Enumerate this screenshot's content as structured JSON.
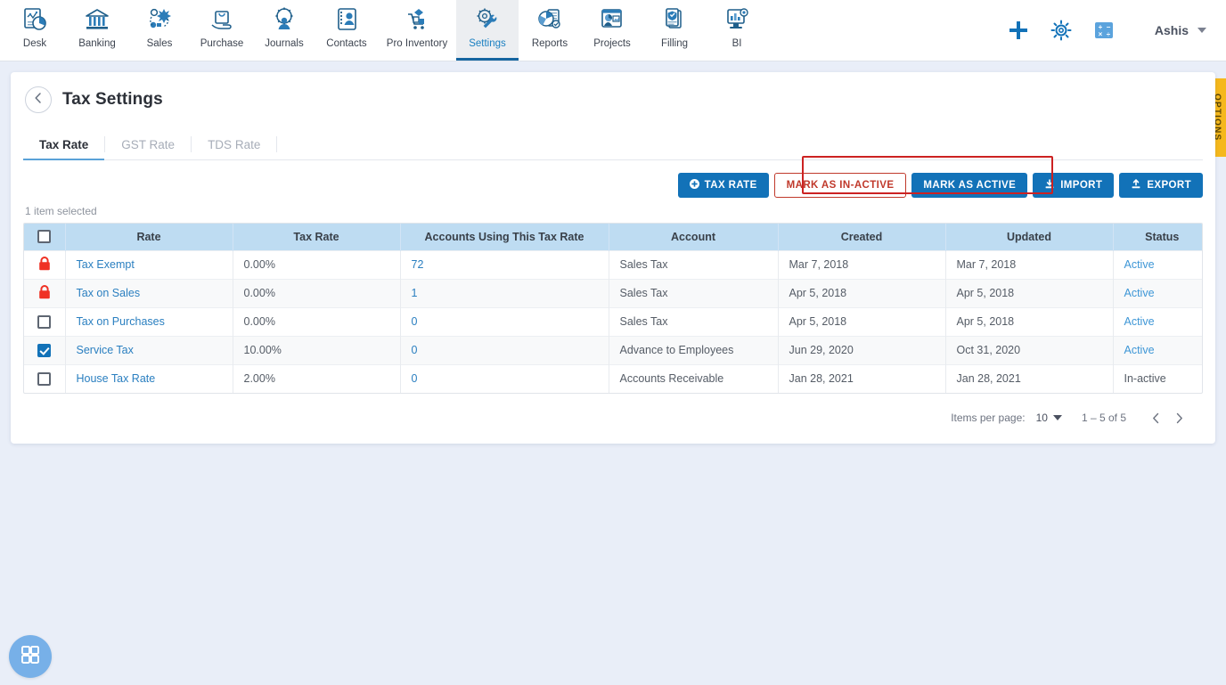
{
  "topnav": {
    "items": [
      {
        "label": "Desk",
        "icon": "desk-chart-icon"
      },
      {
        "label": "Banking",
        "icon": "bank-building-icon"
      },
      {
        "label": "Sales",
        "icon": "sales-network-icon"
      },
      {
        "label": "Purchase",
        "icon": "purchase-bag-hand-icon"
      },
      {
        "label": "Journals",
        "icon": "journals-gear-person-icon"
      },
      {
        "label": "Contacts",
        "icon": "contacts-card-icon"
      },
      {
        "label": "Pro Inventory",
        "icon": "inventory-cart-icon"
      },
      {
        "label": "Settings",
        "icon": "settings-gear-wrench-icon"
      },
      {
        "label": "Reports",
        "icon": "reports-pie-doc-icon"
      },
      {
        "label": "Projects",
        "icon": "projects-board-icon"
      },
      {
        "label": "Filling",
        "icon": "filling-shield-doc-icon"
      },
      {
        "label": "BI",
        "icon": "bi-monitor-icon"
      }
    ],
    "active_index": 7,
    "actions": [
      {
        "name": "add",
        "icon": "plus-icon"
      },
      {
        "name": "settings",
        "icon": "gear-icon"
      },
      {
        "name": "calculator",
        "icon": "calculator-icon"
      }
    ],
    "user": {
      "name": "Ashis",
      "caret": "chevron-down-icon"
    }
  },
  "page": {
    "title": "Tax Settings",
    "back_icon": "chevron-left-icon",
    "options_tab_label": "OPTIONS"
  },
  "tabs": [
    {
      "label": "Tax Rate",
      "active": true
    },
    {
      "label": "GST Rate",
      "active": false
    },
    {
      "label": "TDS Rate",
      "active": false
    }
  ],
  "toolbar": {
    "tax_rate_label": "TAX RATE",
    "tax_rate_icon": "plus-circle-icon",
    "mark_inactive_label": "MARK AS IN-ACTIVE",
    "mark_active_label": "MARK AS ACTIVE",
    "import_label": "IMPORT",
    "import_icon": "upload-icon",
    "export_label": "EXPORT",
    "export_icon": "download-icon",
    "highlight_color": "#cc2222",
    "primary_color": "#1272b8",
    "danger_color": "#c0392b"
  },
  "selection": {
    "note": "1 item selected"
  },
  "table": {
    "columns": [
      "",
      "Rate",
      "Tax Rate",
      "Accounts Using This Tax Rate",
      "Account",
      "Created",
      "Updated",
      "Status"
    ],
    "header_checkbox": {
      "state": "unchecked",
      "icon": "checkbox-icon"
    },
    "rows": [
      {
        "selector": "locked",
        "selector_icon": "lock-icon",
        "rate": "Tax Exempt",
        "tax_rate": "0.00%",
        "accounts_using": "72",
        "account": "Sales Tax",
        "created": "Mar 7, 2018",
        "updated": "Mar 7, 2018",
        "status": "Active"
      },
      {
        "selector": "locked",
        "selector_icon": "lock-icon",
        "rate": "Tax on Sales",
        "tax_rate": "0.00%",
        "accounts_using": "1",
        "account": "Sales Tax",
        "created": "Apr 5, 2018",
        "updated": "Apr 5, 2018",
        "status": "Active"
      },
      {
        "selector": "unchecked",
        "selector_icon": "checkbox-icon",
        "rate": "Tax on Purchases",
        "tax_rate": "0.00%",
        "accounts_using": "0",
        "account": "Sales Tax",
        "created": "Apr 5, 2018",
        "updated": "Apr 5, 2018",
        "status": "Active"
      },
      {
        "selector": "checked",
        "selector_icon": "checkbox-icon",
        "rate": "Service Tax",
        "tax_rate": "10.00%",
        "accounts_using": "0",
        "account": "Advance to Employees",
        "created": "Jun 29, 2020",
        "updated": "Oct 31, 2020",
        "status": "Active"
      },
      {
        "selector": "unchecked",
        "selector_icon": "checkbox-icon",
        "rate": "House Tax Rate",
        "tax_rate": "2.00%",
        "accounts_using": "0",
        "account": "Accounts Receivable",
        "created": "Jan 28, 2021",
        "updated": "Jan 28, 2021",
        "status": "In-active"
      }
    ]
  },
  "paginator": {
    "items_per_page_label": "Items per page:",
    "items_per_page_value": "10",
    "range_label": "1 – 5 of 5",
    "prev_icon": "chevron-left-icon",
    "next_icon": "chevron-right-icon"
  },
  "fab": {
    "icon": "grid-apps-icon"
  }
}
